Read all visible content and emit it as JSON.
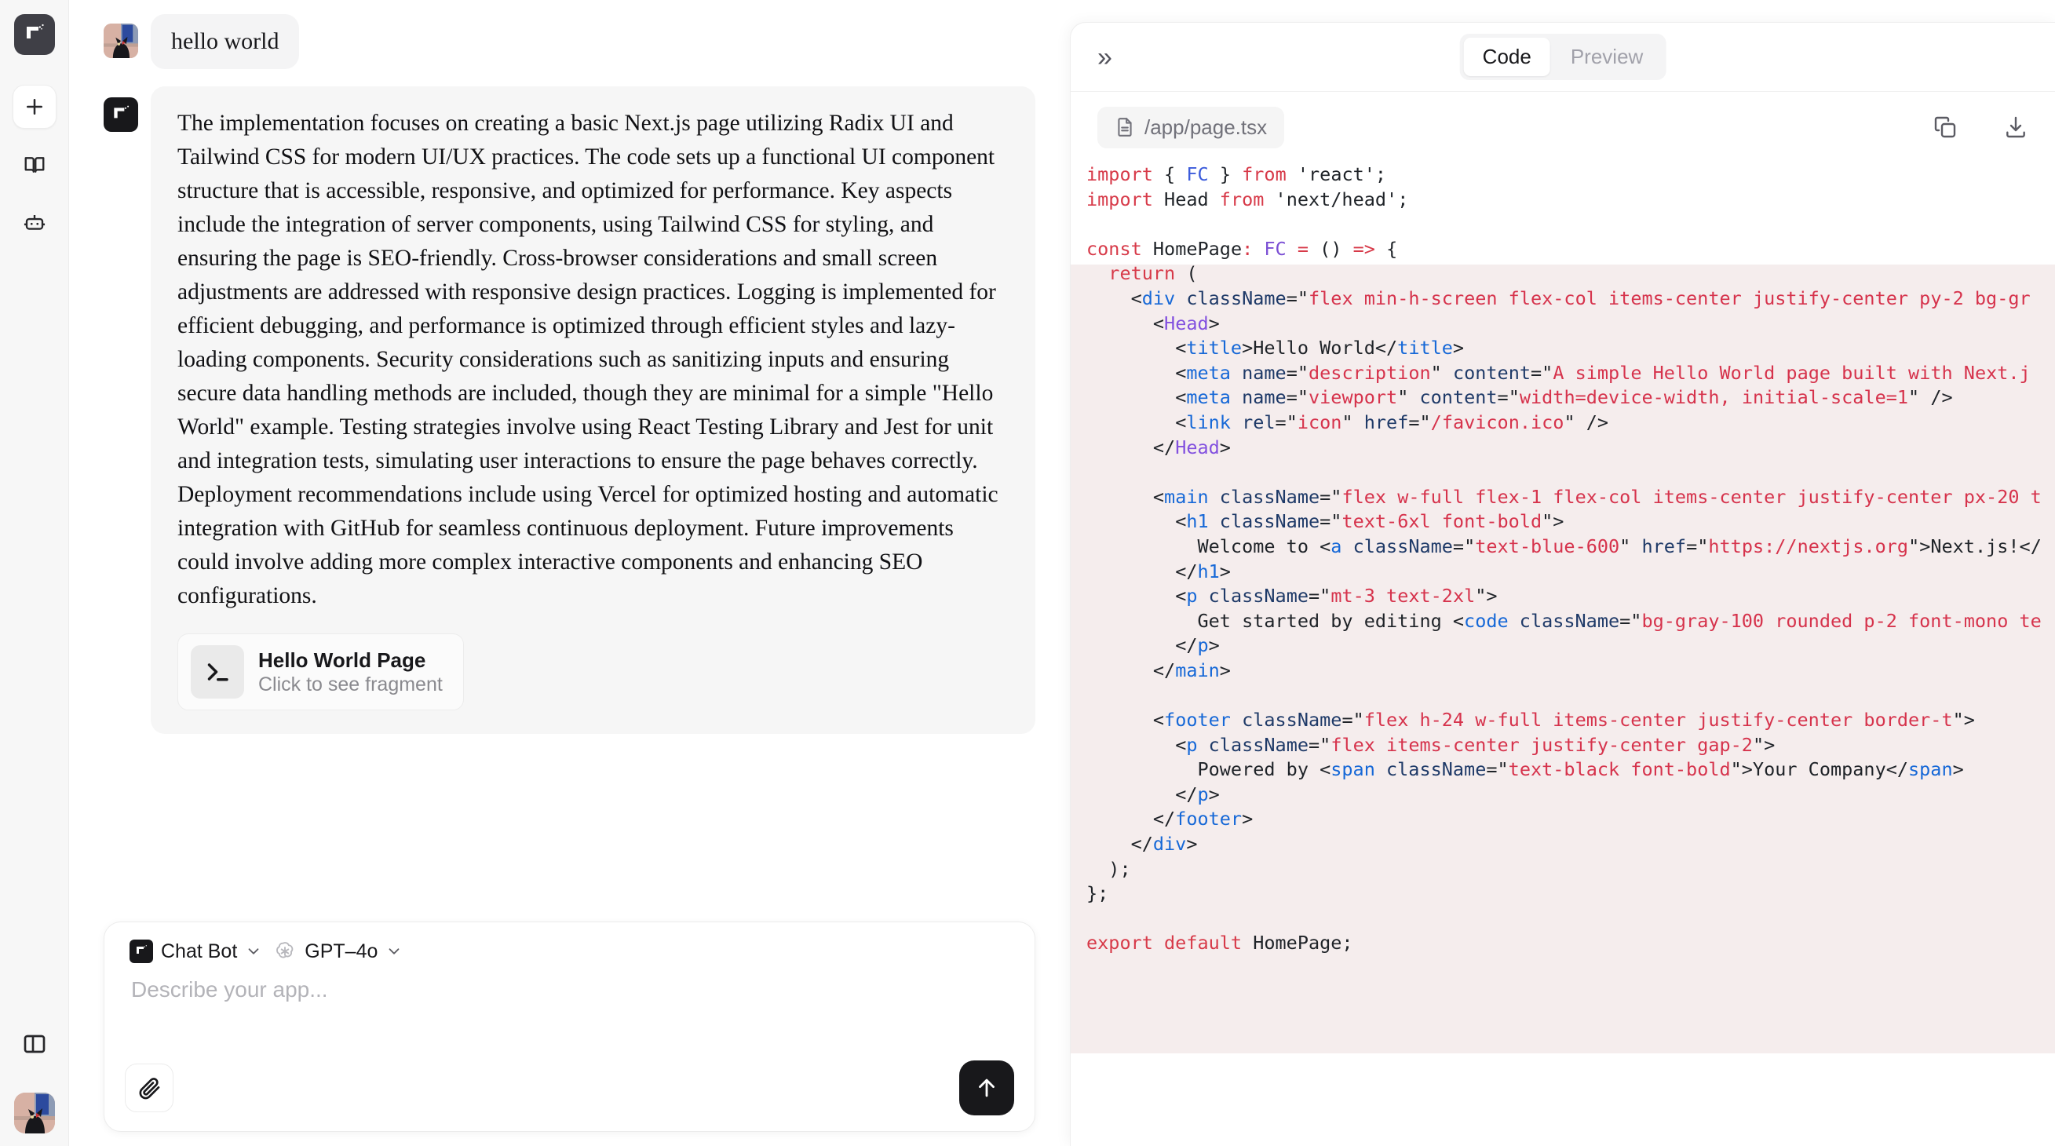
{
  "rail": {
    "logo_icon": "app-logo-icon",
    "items": [
      {
        "icon": "plus-icon",
        "name": "new-chat"
      },
      {
        "icon": "book-icon",
        "name": "library"
      },
      {
        "icon": "robot-icon",
        "name": "bots"
      }
    ],
    "panel_toggle_icon": "panel-toggle-icon",
    "avatar_icon": "user-avatar"
  },
  "chat": {
    "user_message": "hello world",
    "assistant_message": "The implementation focuses on creating a basic Next.js page utilizing Radix UI and Tailwind CSS for modern UI/UX practices. The code sets up a functional UI component structure that is accessible, responsive, and optimized for performance. Key aspects include the integration of server components, using Tailwind CSS for styling, and ensuring the page is SEO-friendly. Cross-browser considerations and small screen adjustments are addressed with responsive design practices. Logging is implemented for efficient debugging, and performance is optimized through efficient styles and lazy-loading components. Security considerations such as sanitizing inputs and ensuring secure data handling methods are included, though they are minimal for a simple \"Hello World\" example. Testing strategies involve using React Testing Library and Jest for unit and integration tests, simulating user interactions to ensure the page behaves correctly. Deployment recommendations include using Vercel for optimized hosting and automatic integration with GitHub for seamless continuous deployment. Future improvements could involve adding more complex interactive components and enhancing SEO configurations.",
    "fragment": {
      "icon": "terminal-icon",
      "title": "Hello World Page",
      "subtitle": "Click to see fragment"
    }
  },
  "composer": {
    "bot_label": "Chat Bot",
    "bot_icon": "app-logo-icon",
    "model_label": "GPT–4o",
    "model_icon": "openai-icon",
    "chevron": "⌄",
    "placeholder": "Describe your app...",
    "attach_icon": "paperclip-icon",
    "send_icon": "arrow-up-icon"
  },
  "preview": {
    "collapse_icon": "chevrons-right-icon",
    "collapse_glyph": "»",
    "tabs": [
      {
        "label": "Code",
        "active": true
      },
      {
        "label": "Preview",
        "active": false
      }
    ],
    "file": {
      "icon": "file-text-icon",
      "name": "/app/page.tsx"
    },
    "actions": [
      {
        "icon": "copy-icon",
        "name": "copy-code-button"
      },
      {
        "icon": "download-icon",
        "name": "download-code-button"
      }
    ],
    "code_plain": "import { FC } from 'react';\nimport Head from 'next/head';\n\nconst HomePage: FC = () => {\n  return (\n    <div className=\"flex min-h-screen flex-col items-center justify-center py-2 bg-gr\n      <Head>\n        <title>Hello World</title>\n        <meta name=\"description\" content=\"A simple Hello World page built with Next.j\n        <meta name=\"viewport\" content=\"width=device-width, initial-scale=1\" />\n        <link rel=\"icon\" href=\"/favicon.ico\" />\n      </Head>\n\n      <main className=\"flex w-full flex-1 flex-col items-center justify-center px-20 t\n        <h1 className=\"text-6xl font-bold\">\n          Welcome to <a className=\"text-blue-600\" href=\"https://nextjs.org\">Next.js!</\n        </h1>\n        <p className=\"mt-3 text-2xl\">\n          Get started by editing <code className=\"bg-gray-100 rounded p-2 font-mono te\n        </p>\n      </main>\n\n      <footer className=\"flex h-24 w-full items-center justify-center border-t\">\n        <p className=\"flex items-center justify-center gap-2\">\n          Powered by <span className=\"text-black font-bold\">Your Company</span>\n        </p>\n      </footer>\n    </div>\n  );\n};\n\nexport default HomePage;"
  },
  "colors": {
    "accent": "#18181b",
    "code_keyword": "#d73a49",
    "code_tag": "#1668d7",
    "code_component": "#8250df",
    "code_attr_value": "#d6334c",
    "jsx_highlight": "#efe2e2",
    "rail_bg": "#f7f7f7",
    "bubble_bg": "#f4f4f5"
  }
}
